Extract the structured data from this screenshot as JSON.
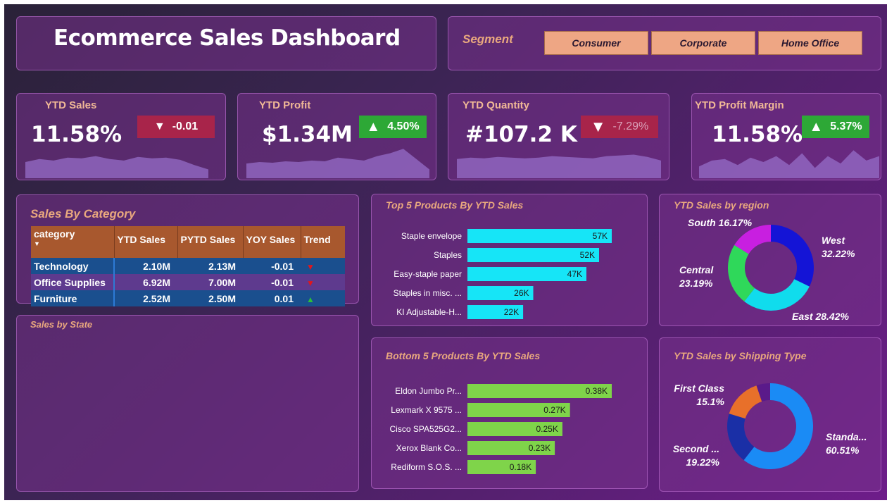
{
  "header": {
    "title": "Ecommerce Sales Dashboard"
  },
  "segment": {
    "label": "Segment",
    "options": [
      "Consumer",
      "Corporate",
      "Home Office"
    ]
  },
  "kpis": [
    {
      "label": "YTD Sales",
      "value": "11.58%",
      "delta": "-0.01",
      "direction": "down",
      "spark": [
        22,
        26,
        24,
        28,
        27,
        30,
        26,
        24,
        29,
        27,
        28,
        25,
        18,
        12
      ]
    },
    {
      "label": "YTD Profit",
      "value": "$1.34M",
      "delta": "4.50%",
      "direction": "up",
      "spark": [
        20,
        22,
        21,
        23,
        22,
        24,
        23,
        28,
        26,
        24,
        30,
        34,
        40,
        26,
        12
      ]
    },
    {
      "label": "YTD Quantity",
      "value": "#107.2 K",
      "delta": "-7.29%",
      "direction": "down",
      "spark": [
        26,
        28,
        27,
        29,
        28,
        27,
        28,
        30,
        29,
        28,
        27,
        30,
        31,
        32,
        29,
        24
      ]
    },
    {
      "label": "YTD Profit Margin",
      "value": "11.58%",
      "delta": "5.37%",
      "direction": "up",
      "spark": [
        16,
        24,
        26,
        18,
        28,
        22,
        30,
        18,
        34,
        14,
        30,
        20,
        38,
        24,
        30
      ]
    }
  ],
  "sales_by_category": {
    "title": "Sales By Category",
    "columns": [
      "category",
      "YTD Sales",
      "PYTD Sales",
      "YOY Sales",
      "Trend"
    ],
    "rows": [
      {
        "category": "Technology",
        "ytd": "2.10M",
        "pytd": "2.13M",
        "yoy": "-0.01",
        "trend": "down"
      },
      {
        "category": "Office Supplies",
        "ytd": "6.92M",
        "pytd": "7.00M",
        "yoy": "-0.01",
        "trend": "down"
      },
      {
        "category": "Furniture",
        "ytd": "2.52M",
        "pytd": "2.50M",
        "yoy": "0.01",
        "trend": "up"
      }
    ]
  },
  "sales_by_state": {
    "title": "Sales by State"
  },
  "colors": {
    "top_bar": "#16e5f7",
    "bottom_bar": "#7fd44a",
    "region": {
      "West": "#1414d6",
      "East": "#10dced",
      "Central": "#2fd85a",
      "South": "#c81fe0"
    },
    "shipping": {
      "Standard": "#1a8bf5",
      "Second Class": "#1a2fa6",
      "First Class": "#e8702a",
      "Same Day": "#5a1a8a"
    }
  },
  "chart_data": [
    {
      "type": "bar",
      "orientation": "horizontal",
      "title": "Top 5 Products By YTD Sales",
      "categories": [
        "Staple envelope",
        "Staples",
        "Easy-staple paper",
        "Staples in misc. ...",
        "KI Adjustable-H..."
      ],
      "values": [
        57,
        52,
        47,
        26,
        22
      ],
      "value_labels": [
        "57K",
        "52K",
        "47K",
        "26K",
        "22K"
      ],
      "unit": "K"
    },
    {
      "type": "bar",
      "orientation": "horizontal",
      "title": "Bottom 5 Products By YTD Sales",
      "categories": [
        "Eldon Jumbo Pr...",
        "Lexmark X 9575 ...",
        "Cisco SPA525G2...",
        "Xerox Blank Co...",
        "Rediform S.O.S. ..."
      ],
      "values": [
        0.38,
        0.27,
        0.25,
        0.23,
        0.18
      ],
      "value_labels": [
        "0.38K",
        "0.27K",
        "0.25K",
        "0.23K",
        "0.18K"
      ],
      "unit": "K"
    },
    {
      "type": "pie",
      "donut": true,
      "title": "YTD Sales by region",
      "slices": [
        {
          "label": "West",
          "pct_label": "32.22%",
          "value": 32.22
        },
        {
          "label": "East",
          "pct_label": "28.42%",
          "value": 28.42
        },
        {
          "label": "Central",
          "pct_label": "23.19%",
          "value": 23.19
        },
        {
          "label": "South",
          "pct_label": "16.17%",
          "value": 16.17
        }
      ]
    },
    {
      "type": "pie",
      "donut": true,
      "title": "YTD Sales by Shipping Type",
      "slices": [
        {
          "label": "Standa...",
          "pct_label": "60.51%",
          "value": 60.51
        },
        {
          "label": "Second ...",
          "pct_label": "19.22%",
          "value": 19.22
        },
        {
          "label": "First Class",
          "pct_label": "15.1%",
          "value": 15.1
        },
        {
          "label": "",
          "pct_label": "",
          "value": 5.17
        }
      ]
    }
  ]
}
